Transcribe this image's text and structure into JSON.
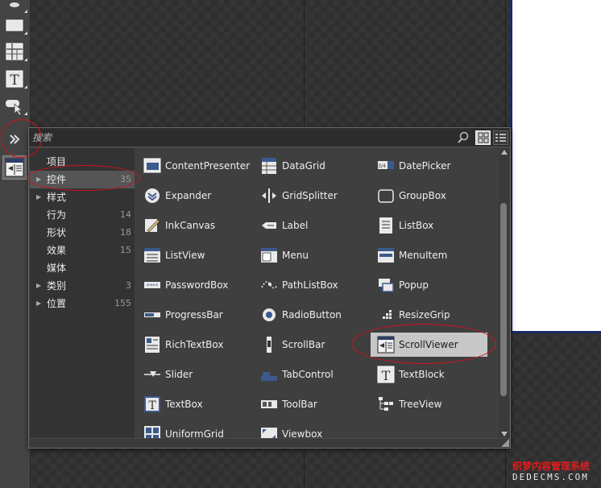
{
  "search": {
    "placeholder": "搜索"
  },
  "categories": [
    {
      "label": "项目",
      "count": "",
      "arrow": false,
      "selected": false
    },
    {
      "label": "控件",
      "count": "35",
      "arrow": true,
      "selected": true
    },
    {
      "label": "样式",
      "count": "",
      "arrow": true,
      "selected": false
    },
    {
      "label": "行为",
      "count": "14",
      "arrow": false,
      "selected": false
    },
    {
      "label": "形状",
      "count": "18",
      "arrow": false,
      "selected": false
    },
    {
      "label": "效果",
      "count": "15",
      "arrow": false,
      "selected": false
    },
    {
      "label": "媒体",
      "count": "",
      "arrow": false,
      "selected": false
    },
    {
      "label": "类别",
      "count": "3",
      "arrow": true,
      "selected": false
    },
    {
      "label": "位置",
      "count": "155",
      "arrow": true,
      "selected": false
    }
  ],
  "controls": [
    {
      "name": "ContentPresenter",
      "icon": "content-presenter-icon"
    },
    {
      "name": "DataGrid",
      "icon": "datagrid-icon"
    },
    {
      "name": "DatePicker",
      "icon": "datepicker-icon"
    },
    {
      "name": "Expander",
      "icon": "expander-icon"
    },
    {
      "name": "GridSplitter",
      "icon": "gridsplitter-icon"
    },
    {
      "name": "GroupBox",
      "icon": "groupbox-icon"
    },
    {
      "name": "InkCanvas",
      "icon": "inkcanvas-icon"
    },
    {
      "name": "Label",
      "icon": "label-icon"
    },
    {
      "name": "ListBox",
      "icon": "listbox-icon"
    },
    {
      "name": "ListView",
      "icon": "listview-icon"
    },
    {
      "name": "Menu",
      "icon": "menu-icon"
    },
    {
      "name": "MenuItem",
      "icon": "menuitem-icon"
    },
    {
      "name": "PasswordBox",
      "icon": "passwordbox-icon"
    },
    {
      "name": "PathListBox",
      "icon": "pathlistbox-icon"
    },
    {
      "name": "Popup",
      "icon": "popup-icon"
    },
    {
      "name": "ProgressBar",
      "icon": "progressbar-icon"
    },
    {
      "name": "RadioButton",
      "icon": "radiobutton-icon"
    },
    {
      "name": "ResizeGrip",
      "icon": "resizegrip-icon"
    },
    {
      "name": "RichTextBox",
      "icon": "richtextbox-icon"
    },
    {
      "name": "ScrollBar",
      "icon": "scrollbar-icon"
    },
    {
      "name": "ScrollViewer",
      "icon": "scrollviewer-icon",
      "selected": true
    },
    {
      "name": "Slider",
      "icon": "slider-icon"
    },
    {
      "name": "TabControl",
      "icon": "tabcontrol-icon"
    },
    {
      "name": "TextBlock",
      "icon": "textblock-icon"
    },
    {
      "name": "TextBox",
      "icon": "textbox-icon"
    },
    {
      "name": "ToolBar",
      "icon": "toolbar-icon"
    },
    {
      "name": "TreeView",
      "icon": "treeview-icon"
    },
    {
      "name": "UniformGrid",
      "icon": "uniformgrid-icon"
    },
    {
      "name": "Viewbox",
      "icon": "viewbox-icon"
    }
  ],
  "watermark": {
    "cn": "织梦内容管理系统",
    "en": "DEDECMS.COM"
  },
  "colors": {
    "selection": "#c7c7c7",
    "annotation": "#d0131a",
    "doc_border": "#1b2a63"
  }
}
